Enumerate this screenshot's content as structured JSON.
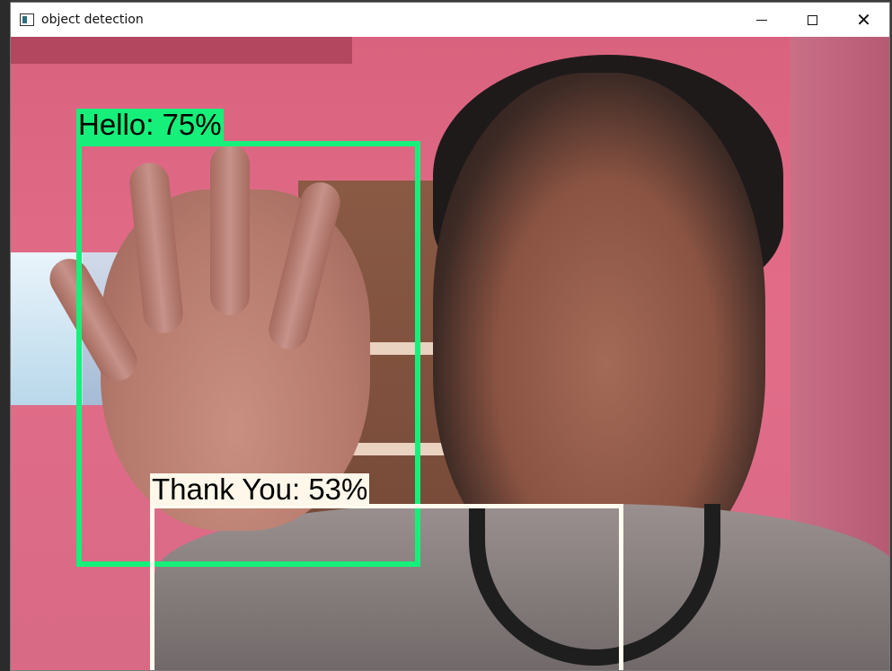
{
  "window": {
    "title": "object detection",
    "controls": {
      "minimize": "",
      "maximize": "",
      "close": "✕"
    }
  },
  "detections": [
    {
      "label": "Hello: 75%",
      "color": "#16f07a"
    },
    {
      "label": "Thank You: 53%",
      "color": "#fffbef"
    }
  ]
}
